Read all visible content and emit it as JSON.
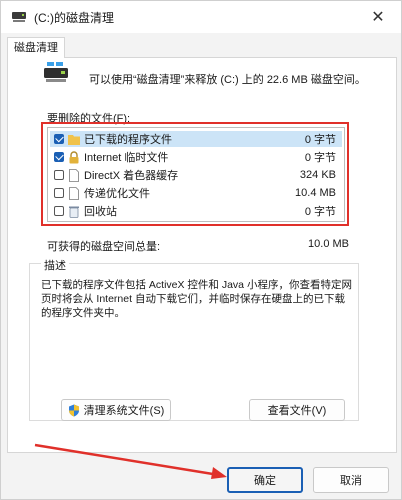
{
  "window": {
    "title": "(C:)的磁盘清理"
  },
  "tab": {
    "label": "磁盘清理"
  },
  "summary": {
    "text": "可以使用“磁盘清理”来释放 (C:) 上的 22.6 MB 磁盘空间。"
  },
  "files": {
    "label": "要删除的文件(F):",
    "items": [
      {
        "name": "已下载的程序文件",
        "size": "0 字节",
        "checked": true,
        "selected": true,
        "icon": "folder-icon"
      },
      {
        "name": "Internet 临时文件",
        "size": "0 字节",
        "checked": true,
        "selected": false,
        "icon": "lock-icon"
      },
      {
        "name": "DirectX 着色器缓存",
        "size": "324 KB",
        "checked": false,
        "selected": false,
        "icon": "file-icon"
      },
      {
        "name": "传递优化文件",
        "size": "10.4 MB",
        "checked": false,
        "selected": false,
        "icon": "file-icon"
      },
      {
        "name": "回收站",
        "size": "0 字节",
        "checked": false,
        "selected": false,
        "icon": "recycle-bin-icon"
      }
    ]
  },
  "total": {
    "label": "可获得的磁盘空间总量:",
    "value": "10.0 MB"
  },
  "description": {
    "title": "描述",
    "text": "已下载的程序文件包括 ActiveX 控件和 Java 小程序，你查看特定网页时将会从 Internet 自动下载它们，并临时保存在硬盘上的已下载的程序文件夹中。"
  },
  "buttons": {
    "system_label": "清理系统文件(S)",
    "view_label": "查看文件(V)",
    "ok_label": "确定",
    "cancel_label": "取消"
  },
  "colors": {
    "accent": "#1a5fb4",
    "highlight_frame": "#e0302a",
    "selection": "#cce4f7"
  }
}
